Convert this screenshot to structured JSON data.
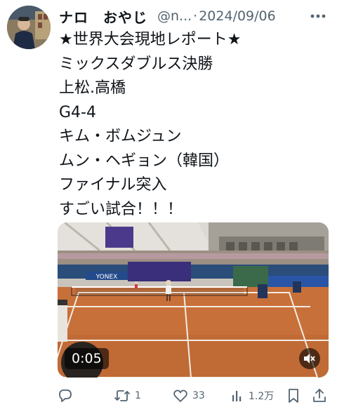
{
  "tweet": {
    "author_name": "ナロ　おやじ",
    "handle": "@n...",
    "separator": "·",
    "date": "2024/09/06",
    "text_lines": [
      "★世界大会現地レポート★",
      "ミックスダブルス決勝",
      "上松.高橋",
      "G4-4",
      "キム・ボムジュン",
      "ムン・ヘギョン（韓国）",
      "ファイナル突入",
      "すごい試合！！！"
    ]
  },
  "video": {
    "time": "0:05",
    "sponsor_banner": "YONEX",
    "court_color": "#c8703a",
    "court_line_color": "#f3ece2"
  },
  "actions": {
    "reply_count": "",
    "retweet_count": "1",
    "like_count": "33",
    "views_count": "1.2万"
  },
  "icons": {
    "more": "more-icon",
    "reply": "reply-icon",
    "retweet": "retweet-icon",
    "like": "heart-icon",
    "views": "views-icon",
    "bookmark": "bookmark-icon",
    "share": "share-icon",
    "mute": "mute-icon"
  },
  "colors": {
    "text": "#0f1419",
    "secondary": "#536471"
  }
}
